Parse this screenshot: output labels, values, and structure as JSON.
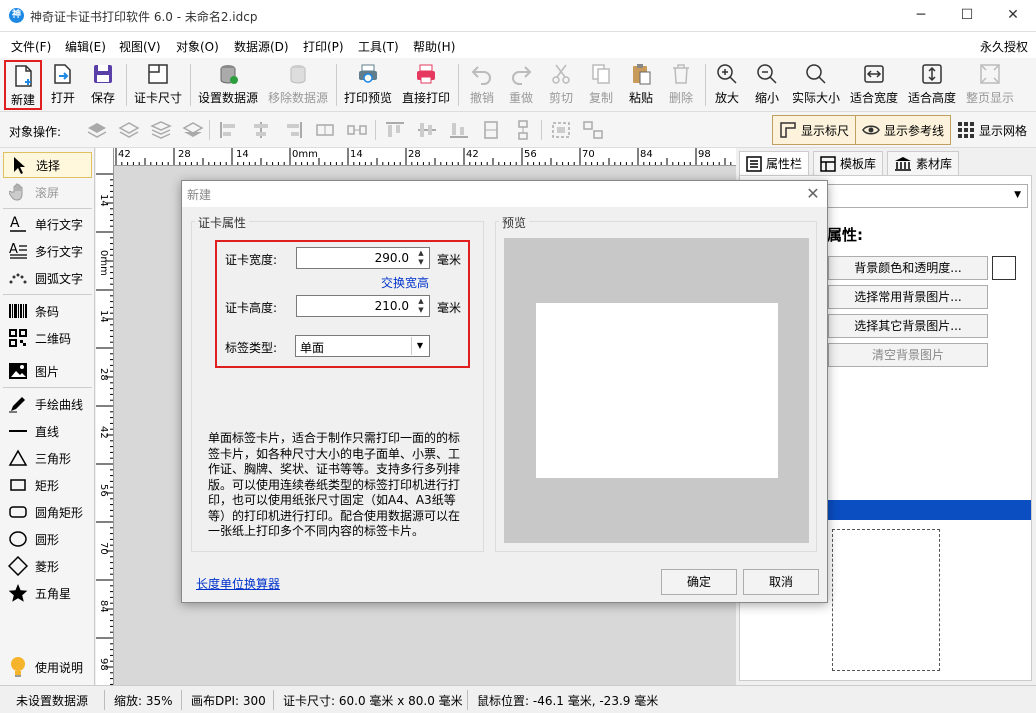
{
  "window": {
    "title": "神奇证卡证书打印软件 6.0 - 未命名2.idcp",
    "app_icon": "神",
    "controls": [
      "─",
      "☐",
      "✕"
    ]
  },
  "menu": {
    "items": [
      "文件(F)",
      "编辑(E)",
      "视图(V)",
      "对象(O)",
      "数据源(D)",
      "打印(P)",
      "工具(T)",
      "帮助(H)"
    ],
    "license": "永久授权"
  },
  "toolbar": {
    "buttons": [
      {
        "label": "新建",
        "icon": "new-file-icon",
        "enabled": true
      },
      {
        "label": "打开",
        "icon": "open-icon",
        "enabled": true
      },
      {
        "label": "保存",
        "icon": "save-icon",
        "enabled": true
      },
      {
        "label": "证卡尺寸",
        "icon": "card-size-icon",
        "enabled": true
      },
      {
        "label": "设置数据源",
        "icon": "database-icon",
        "enabled": true
      },
      {
        "label": "移除数据源",
        "icon": "database-remove-icon",
        "enabled": false
      },
      {
        "label": "打印预览",
        "icon": "print-preview-icon",
        "enabled": true
      },
      {
        "label": "直接打印",
        "icon": "printer-icon",
        "enabled": true
      },
      {
        "label": "撤销",
        "icon": "undo-icon",
        "enabled": false
      },
      {
        "label": "重做",
        "icon": "redo-icon",
        "enabled": false
      },
      {
        "label": "剪切",
        "icon": "cut-icon",
        "enabled": false
      },
      {
        "label": "复制",
        "icon": "copy-icon",
        "enabled": false
      },
      {
        "label": "粘贴",
        "icon": "paste-icon",
        "enabled": true
      },
      {
        "label": "删除",
        "icon": "delete-icon",
        "enabled": false
      },
      {
        "label": "放大",
        "icon": "zoom-in-icon",
        "enabled": true
      },
      {
        "label": "缩小",
        "icon": "zoom-out-icon",
        "enabled": true
      },
      {
        "label": "实际大小",
        "icon": "actual-size-icon",
        "enabled": true
      },
      {
        "label": "适合宽度",
        "icon": "fit-width-icon",
        "enabled": true
      },
      {
        "label": "适合高度",
        "icon": "fit-height-icon",
        "enabled": true
      },
      {
        "label": "整页显示",
        "icon": "full-page-icon",
        "enabled": false
      }
    ]
  },
  "toolbar2": {
    "label": "对象操作:",
    "show_ruler": "显示标尺",
    "show_guides": "显示参考线",
    "show_grid": "显示网格"
  },
  "tools": [
    {
      "label": "选择",
      "icon": "select-arrow-icon",
      "active": true,
      "enabled": true
    },
    {
      "label": "滚屏",
      "icon": "hand-pan-icon",
      "active": false,
      "enabled": false
    },
    {
      "label": "单行文字",
      "icon": "single-line-text-icon",
      "active": false,
      "enabled": true
    },
    {
      "label": "多行文字",
      "icon": "multi-line-text-icon",
      "active": false,
      "enabled": true
    },
    {
      "label": "圆弧文字",
      "icon": "arc-text-icon",
      "active": false,
      "enabled": true
    },
    {
      "label": "条码",
      "icon": "barcode-icon",
      "active": false,
      "enabled": true
    },
    {
      "label": "二维码",
      "icon": "qrcode-icon",
      "active": false,
      "enabled": true
    },
    {
      "label": "图片",
      "icon": "image-icon",
      "active": false,
      "enabled": true
    },
    {
      "label": "手绘曲线",
      "icon": "pen-curve-icon",
      "active": false,
      "enabled": true
    },
    {
      "label": "直线",
      "icon": "line-icon",
      "active": false,
      "enabled": true
    },
    {
      "label": "三角形",
      "icon": "triangle-icon",
      "active": false,
      "enabled": true
    },
    {
      "label": "矩形",
      "icon": "rectangle-icon",
      "active": false,
      "enabled": true
    },
    {
      "label": "圆角矩形",
      "icon": "rounded-rectangle-icon",
      "active": false,
      "enabled": true
    },
    {
      "label": "圆形",
      "icon": "circle-icon",
      "active": false,
      "enabled": true
    },
    {
      "label": "菱形",
      "icon": "diamond-icon",
      "active": false,
      "enabled": true
    },
    {
      "label": "五角星",
      "icon": "star-icon",
      "active": false,
      "enabled": true
    }
  ],
  "help_label": "使用说明",
  "rulers": {
    "horizontal_ticks": [
      "42",
      "28",
      "14",
      "0mm",
      "14",
      "28",
      "42",
      "56",
      "70",
      "84",
      "98"
    ],
    "vertical_ticks": [
      "14",
      "0mm",
      "14",
      "28",
      "42",
      "56",
      "70",
      "84",
      "98"
    ]
  },
  "right_panel": {
    "tabs": [
      "属性栏",
      "模板库",
      "素材库"
    ],
    "heading": "属性:",
    "buttons": [
      {
        "label": "背景颜色和透明度...",
        "enabled": true
      },
      {
        "label": "选择常用背景图片...",
        "enabled": true
      },
      {
        "label": "选择其它背景图片...",
        "enabled": true
      },
      {
        "label": "清空背景图片",
        "enabled": false
      }
    ]
  },
  "status": {
    "datasource": "未设置数据源",
    "zoom": "缩放: 35%",
    "dpi": "画布DPI: 300",
    "card_size": "证卡尺寸: 60.0 毫米 x 80.0 毫米",
    "mouse_pos": "鼠标位置: -46.1 毫米, -23.9 毫米"
  },
  "dialog": {
    "title": "新建",
    "group_card": "证卡属性",
    "group_preview": "预览",
    "width_label": "证卡宽度:",
    "width_value": "290.0",
    "height_label": "证卡高度:",
    "height_value": "210.0",
    "unit": "毫米",
    "swap_link": "交换宽高",
    "type_label": "标签类型:",
    "type_value": "单面",
    "description": "单面标签卡片，适合于制作只需打印一面的的标签卡片，如各种尺寸大小的电子面单、小票、工作证、胸牌、奖状、证书等等。支持多行多列排版。可以使用连续卷纸类型的标签打印机进行打印，也可以使用纸张尺寸固定（如A4、A3纸等等）的打印机进行打印。配合使用数据源可以在一张纸上打印多个不同内容的标签卡片。",
    "unit_calc": "长度单位换算器",
    "ok": "确定",
    "cancel": "取消"
  }
}
